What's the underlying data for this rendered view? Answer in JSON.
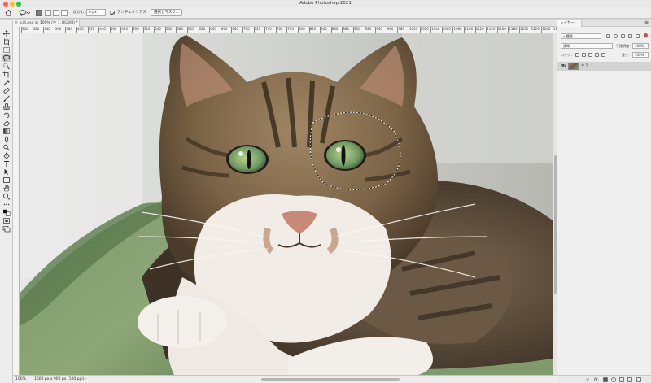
{
  "window": {
    "title": "Adobe Photoshop 2021"
  },
  "options_bar": {
    "feather_label": "ぼかし :",
    "feather_value": "0 px",
    "antialias_label": "アンチエイリアス",
    "antialias_checked": true,
    "select_mask_button": "選択とマスク..."
  },
  "tools": [
    "home-icon",
    "move-icon",
    "artboard-icon",
    "marquee-icon",
    "lasso-icon",
    "quick-select-icon",
    "crop-icon",
    "eyedropper-icon",
    "healing-icon",
    "brush-icon",
    "stamp-icon",
    "history-brush-icon",
    "eraser-icon",
    "gradient-icon",
    "blur-icon",
    "dodge-icon",
    "pen-icon",
    "type-icon",
    "path-select-icon",
    "shape-icon",
    "hand-icon",
    "zoom-icon",
    "more-icon",
    "colors-icon",
    "quickmask-icon",
    "screenmode-icon"
  ],
  "document": {
    "tab_title": "cat.psd @ 100% (キ ?, RGB/8) *",
    "zoom": "100%",
    "info": "1600 px x 900 px (100 ppi)"
  },
  "ruler": {
    "labels": [
      "300",
      "320",
      "340",
      "360",
      "380",
      "400",
      "420",
      "440",
      "460",
      "480",
      "500",
      "520",
      "540",
      "560",
      "580",
      "600",
      "620",
      "640",
      "660",
      "680",
      "700",
      "720",
      "740",
      "760",
      "780",
      "800",
      "820",
      "840",
      "860",
      "880",
      "900",
      "920",
      "940",
      "960",
      "980",
      "1000",
      "1020",
      "1040",
      "1060",
      "1080",
      "1100",
      "1120",
      "1140",
      "1160",
      "1180",
      "1200",
      "1220",
      "1240",
      "1260"
    ]
  },
  "layers_panel": {
    "tab_label": "レイヤー",
    "filter_label": "種類",
    "blend_mode": "通常",
    "opacity_label": "不透明度 :",
    "opacity_value": "100%",
    "lock_label": "ロック :",
    "fill_label": "塗り :",
    "fill_value": "100%",
    "layers": [
      {
        "name": "キ ?",
        "visible": true
      }
    ]
  },
  "colors": {
    "accent": "#3a76d8",
    "panel_bg": "#efefef"
  }
}
